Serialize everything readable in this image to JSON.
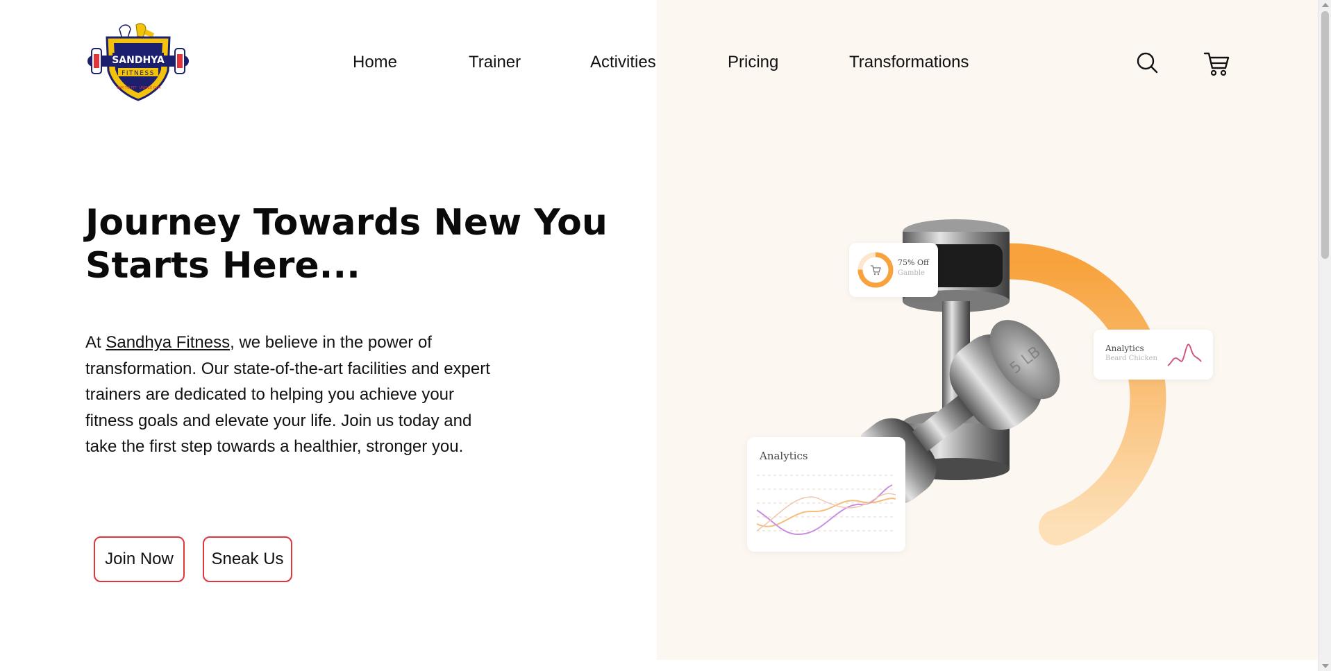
{
  "brand": {
    "name_line1": "SANDHYA",
    "name_line2": "FITNESS",
    "tagline_left": "WAY TO FIT",
    "tagline_right": "UNISEX GYM"
  },
  "nav": {
    "items": [
      {
        "label": "Home"
      },
      {
        "label": "Trainer"
      },
      {
        "label": "Activities"
      },
      {
        "label": "Pricing"
      },
      {
        "label": "Transformations"
      }
    ]
  },
  "header_icons": {
    "search": "search-icon",
    "cart": "cart-icon"
  },
  "hero": {
    "title_line1": "Journey Towards New You",
    "title_line2": "Starts Here...",
    "text_prefix": "At ",
    "text_link": "Sandhya Fitness",
    "text_rest": ", we believe in the power of transformation. Our state-of-the-art facilities and expert trainers are dedicated to helping you achieve your fitness goals and elevate your life. Join us today and take the first step towards a healthier, stronger you.",
    "join_label": "Join Now",
    "sneak_label": "Sneak Us"
  },
  "illustration": {
    "offer_title": "75% Off",
    "offer_sub": "Gamble",
    "analytics_small_title": "Analytics",
    "analytics_small_sub": "Beard Chicken",
    "analytics_big_title": "Analytics",
    "dumbbell_label": "5 LB"
  },
  "colors": {
    "accent_red": "#e0353a",
    "right_panel_bg": "#fdf7f2",
    "ring_orange": "#f7a23c",
    "brand_navy": "#1b1f6e",
    "brand_yellow": "#f3c20c"
  }
}
